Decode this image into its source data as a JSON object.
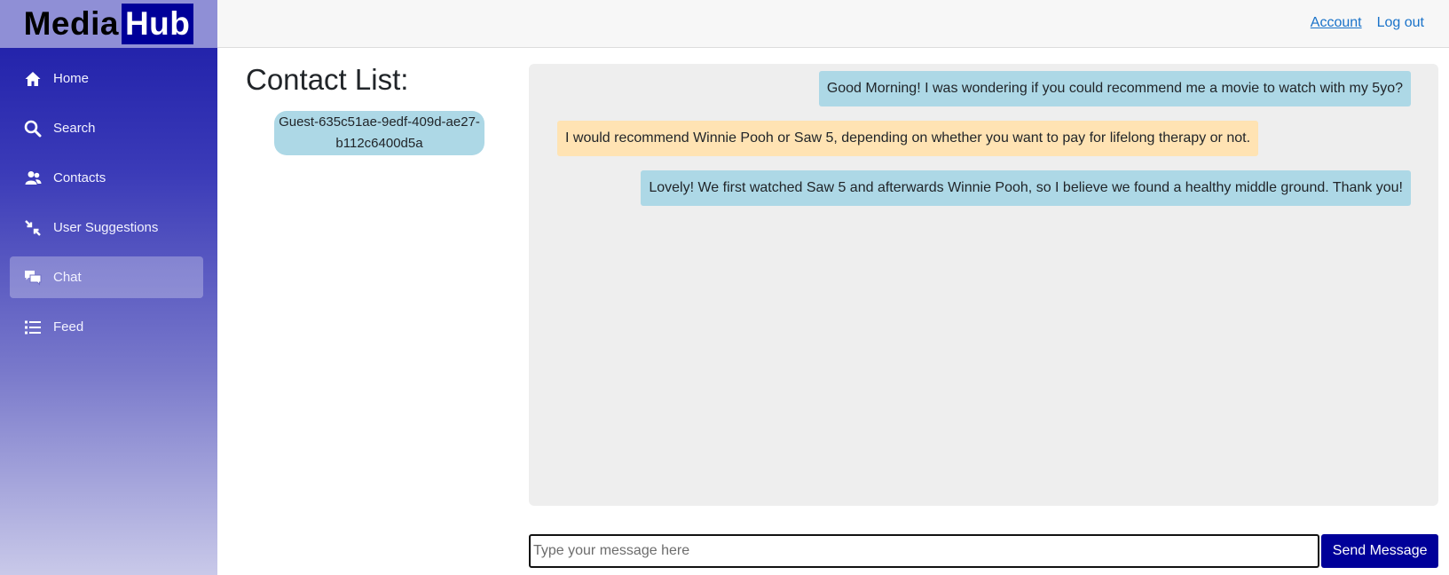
{
  "brand": {
    "part1": "Media",
    "part2": "Hub"
  },
  "header": {
    "account": "Account",
    "logout": "Log out"
  },
  "sidebar": {
    "items": [
      {
        "label": "Home",
        "icon": "home-icon"
      },
      {
        "label": "Search",
        "icon": "search-icon"
      },
      {
        "label": "Contacts",
        "icon": "contacts-icon"
      },
      {
        "label": "User Suggestions",
        "icon": "arrows-in-icon"
      },
      {
        "label": "Chat",
        "icon": "chat-icon",
        "active": true
      },
      {
        "label": "Feed",
        "icon": "list-icon"
      }
    ]
  },
  "contacts": {
    "title": "Contact List:",
    "items": [
      {
        "name": "Guest-635c51ae-9edf-409d-ae27-b112c6400d5a"
      }
    ]
  },
  "chat": {
    "messages": [
      {
        "direction": "outgoing",
        "text": "Good Morning! I was wondering if you could recommend me a movie to watch with my 5yo?"
      },
      {
        "direction": "incoming",
        "text": "I would recommend Winnie Pooh or Saw 5, depending on whether you want to pay for lifelong therapy or not."
      },
      {
        "direction": "outgoing",
        "text": "Lovely! We first watched Saw 5 and afterwards Winnie Pooh, so I believe we found a healthy middle ground. Thank you!"
      }
    ],
    "input_placeholder": "Type your message here",
    "input_value": "",
    "send_label": "Send Message"
  },
  "colors": {
    "brand_dark": "#000099",
    "outgoing_bubble": "#add8e6",
    "incoming_bubble": "#ffe3b3",
    "chat_panel_bg": "#eeeeee",
    "link": "#1a73c9"
  }
}
